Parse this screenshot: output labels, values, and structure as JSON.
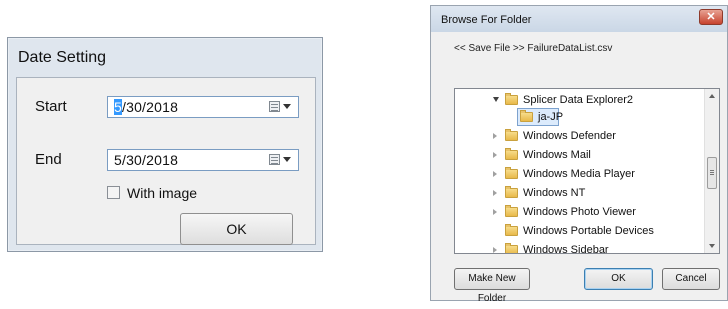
{
  "date_setting": {
    "title": "Date Setting",
    "start_label": "Start",
    "start_value_highlight": "5",
    "start_value_rest": "/30/2018",
    "end_label": "End",
    "end_value": "5/30/2018",
    "with_image_label": "With image",
    "with_image_checked": false,
    "ok_label": "OK"
  },
  "browse_folder": {
    "title": "Browse For Folder",
    "close_glyph": "✕",
    "description": "<< Save File >> FailureDataList.csv",
    "tree_items": [
      {
        "label": "Splicer Data Explorer2",
        "state": "expanded"
      },
      {
        "label": "ja-JP",
        "state": "leaf",
        "selected": true
      },
      {
        "label": "Windows Defender",
        "state": "collapsed"
      },
      {
        "label": "Windows Mail",
        "state": "collapsed"
      },
      {
        "label": "Windows Media Player",
        "state": "collapsed"
      },
      {
        "label": "Windows NT",
        "state": "collapsed"
      },
      {
        "label": "Windows Photo Viewer",
        "state": "collapsed"
      },
      {
        "label": "Windows Portable Devices",
        "state": "leaf"
      },
      {
        "label": "Windows Sidebar",
        "state": "collapsed"
      }
    ],
    "make_new_folder_label": "Make New Folder",
    "ok_label": "OK",
    "cancel_label": "Cancel"
  }
}
